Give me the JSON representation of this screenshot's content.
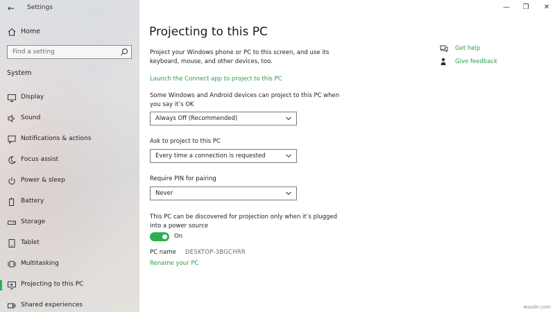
{
  "window": {
    "title": "Settings"
  },
  "sidebar": {
    "home_label": "Home",
    "search_placeholder": "Find a setting",
    "section_title": "System",
    "items": [
      {
        "label": "Display",
        "icon": "display-icon"
      },
      {
        "label": "Sound",
        "icon": "sound-icon"
      },
      {
        "label": "Notifications & actions",
        "icon": "notifications-icon"
      },
      {
        "label": "Focus assist",
        "icon": "moon-icon"
      },
      {
        "label": "Power & sleep",
        "icon": "power-icon"
      },
      {
        "label": "Battery",
        "icon": "battery-icon"
      },
      {
        "label": "Storage",
        "icon": "storage-icon"
      },
      {
        "label": "Tablet",
        "icon": "tablet-icon"
      },
      {
        "label": "Multitasking",
        "icon": "multitasking-icon"
      },
      {
        "label": "Projecting to this PC",
        "icon": "projecting-icon",
        "selected": true
      },
      {
        "label": "Shared experiences",
        "icon": "shared-experiences-icon"
      }
    ]
  },
  "main": {
    "title": "Projecting to this PC",
    "intro": "Project your Windows phone or PC to this screen, and use its keyboard, mouse, and other devices, too.",
    "connect_link": "Launch the Connect app to project to this PC",
    "setting1": {
      "label": "Some Windows and Android devices can project to this PC when you say it’s OK",
      "value": "Always Off (Recommended)"
    },
    "setting2": {
      "label": "Ask to project to this PC",
      "value": "Every time a connection is requested"
    },
    "setting3": {
      "label": "Require PIN for pairing",
      "value": "Never"
    },
    "power_note": "This PC can be discovered for projection only when it’s plugged into a power source",
    "toggle": {
      "state": "On",
      "on": true
    },
    "pc_name_label": "PC name",
    "pc_name_value": "DESKTOP-3BGCHRR",
    "rename_link": "Rename your PC"
  },
  "help": {
    "get_help": "Get help",
    "give_feedback": "Give feedback"
  },
  "watermark": "wsxdn.com",
  "colors": {
    "accent": "#2eae54",
    "link": "#2e9c49"
  }
}
